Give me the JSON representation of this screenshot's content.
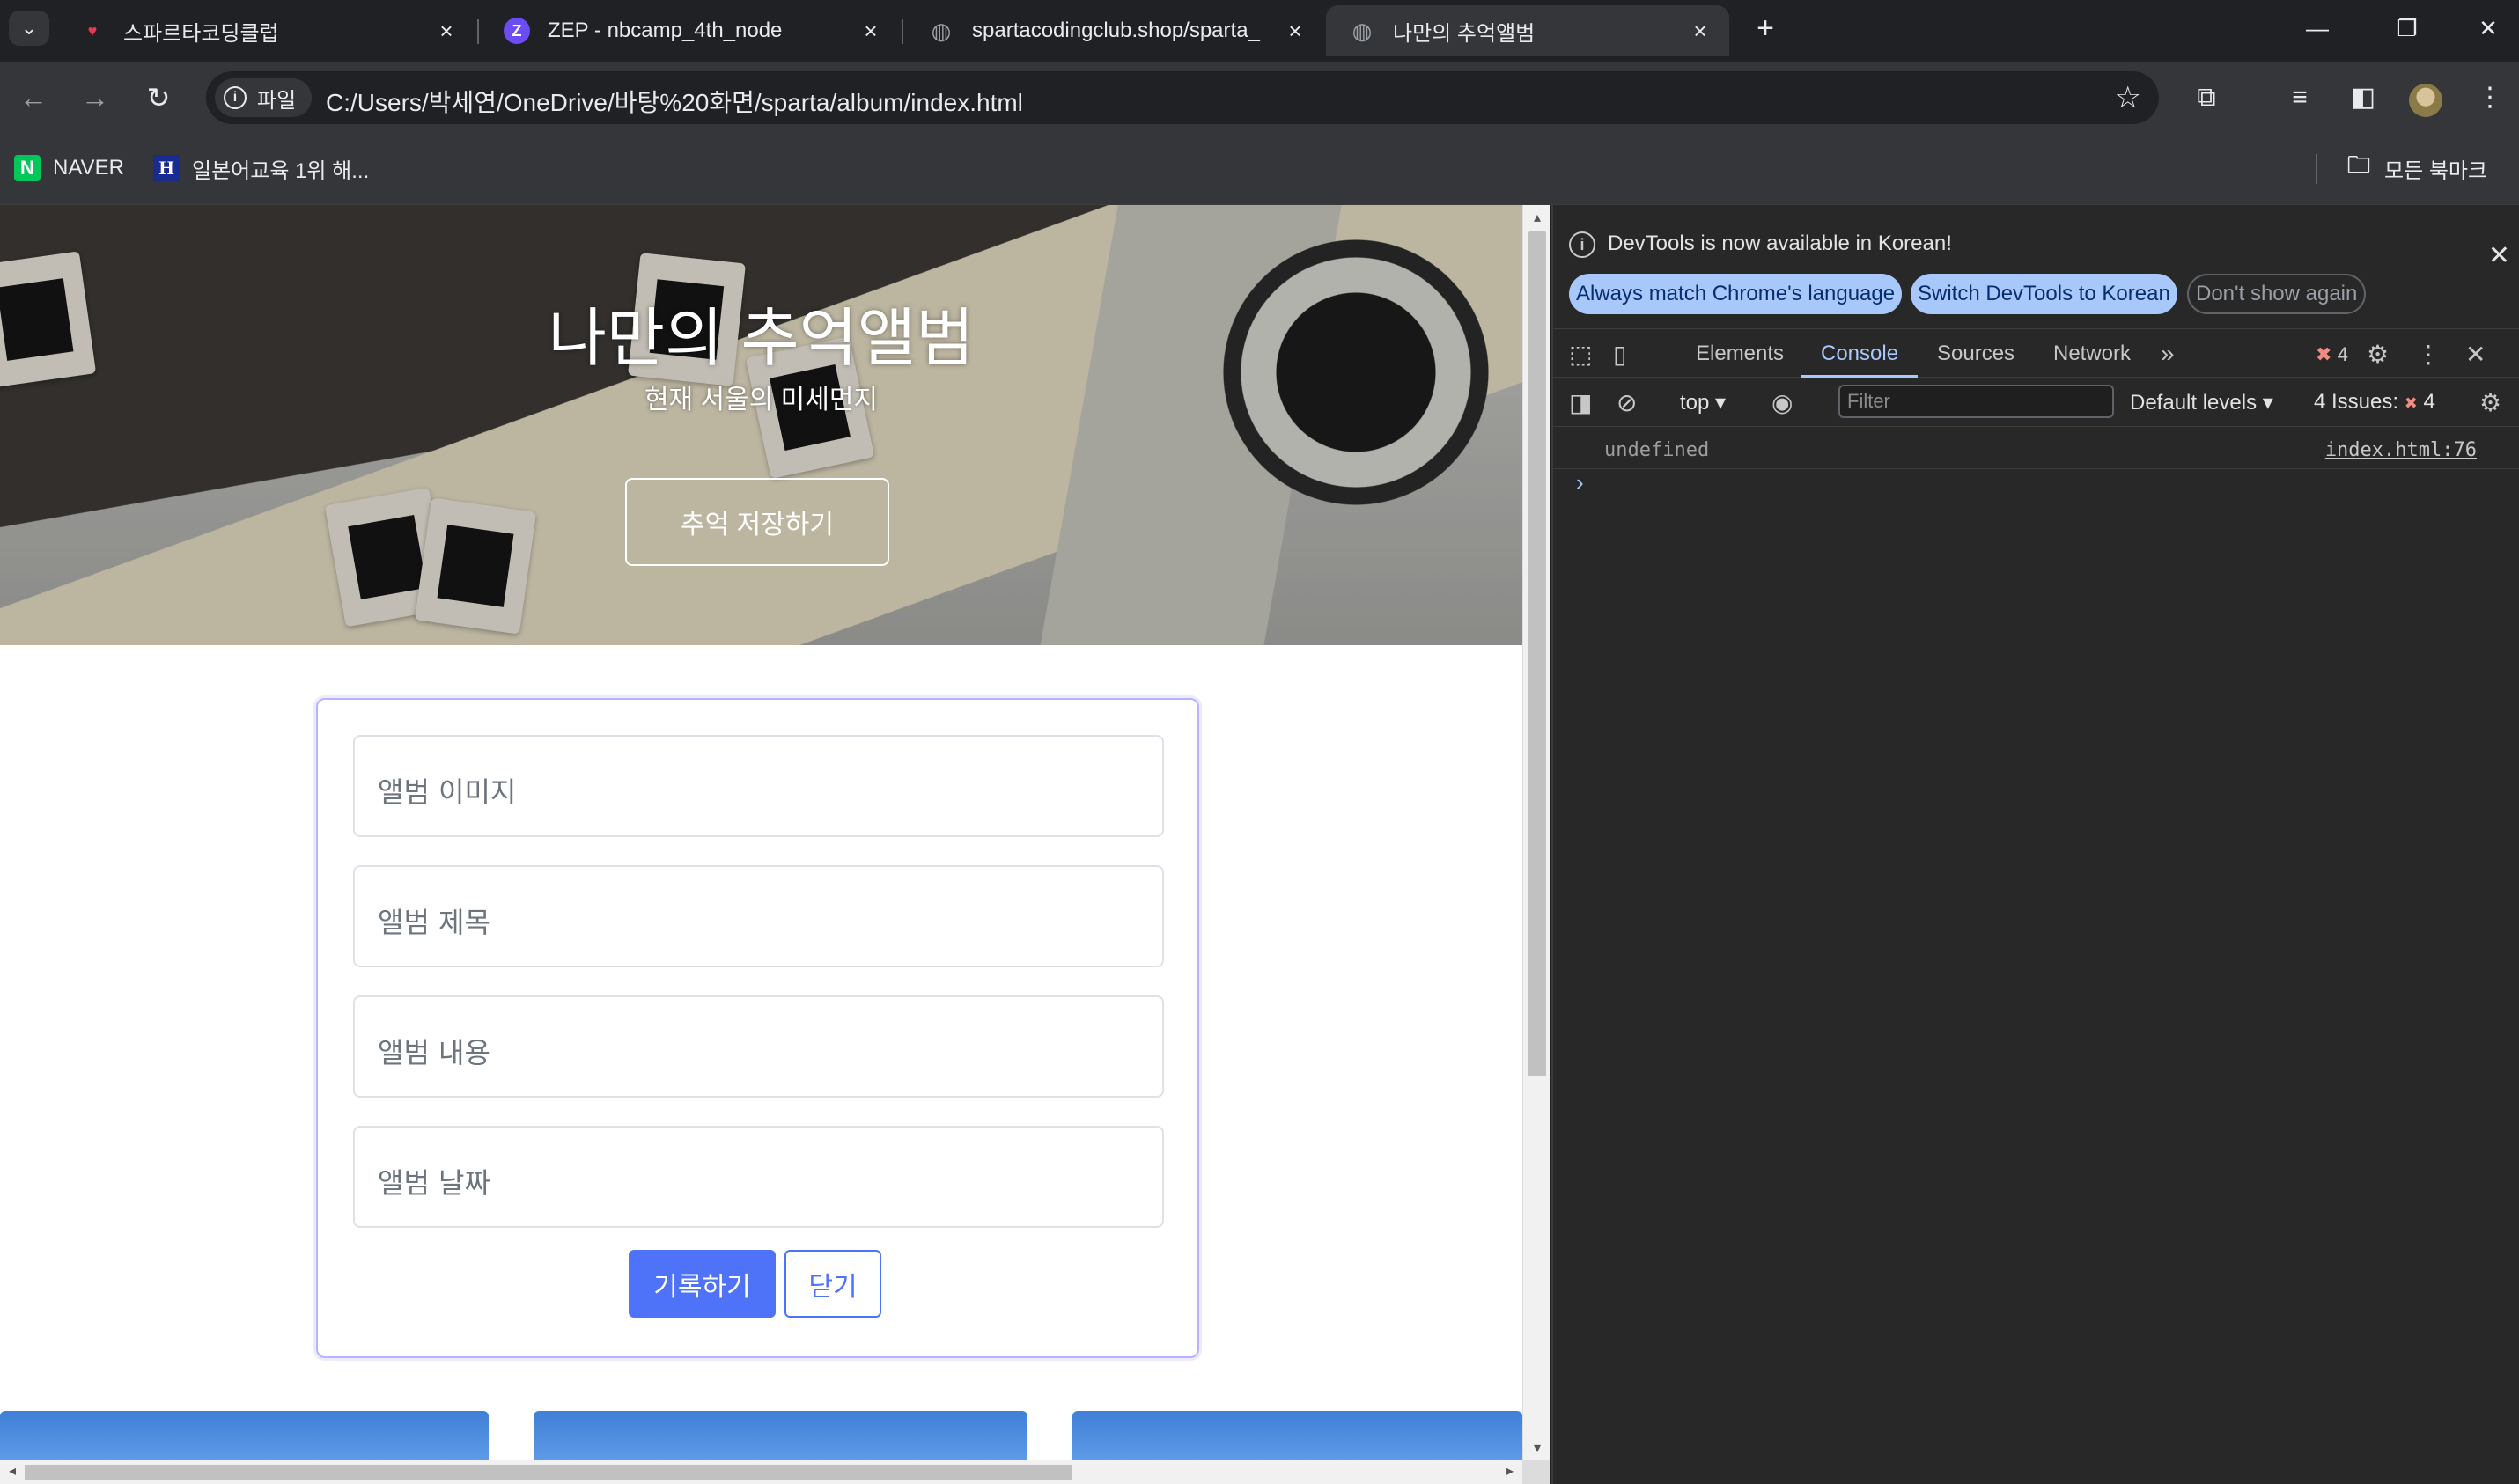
{
  "tabs": [
    {
      "title": "스파르타코딩클럽",
      "icon": "heart-icon",
      "color": "#e8384f"
    },
    {
      "title": "ZEP - nbcamp_4th_node",
      "icon": "zep-icon",
      "color": "#6c4cf5"
    },
    {
      "title": "spartacodingclub.shop/sparta_",
      "icon": "globe-icon",
      "color": "#9aa0a6"
    },
    {
      "title": "나만의 추억앨범",
      "icon": "globe-icon",
      "color": "#9aa0a6",
      "active": true
    }
  ],
  "toolbar": {
    "chip_label": "파일",
    "url": "C:/Users/박세연/OneDrive/바탕%20화면/sparta/album/index.html"
  },
  "bookmarks": {
    "items": [
      {
        "label": "NAVER",
        "icon": "naver-icon",
        "color": "#03c75a"
      },
      {
        "label": "일본어교육 1위 해...",
        "icon": "hackers-icon",
        "color": "#1a2b8f"
      }
    ],
    "all_bookmarks": "모든 북마크"
  },
  "page": {
    "hero": {
      "title": "나만의 추억앨범",
      "subtitle": "현재 서울의 미세먼지",
      "button": "추억 저장하기"
    },
    "form": {
      "fields": [
        "앨범 이미지",
        "앨범 제목",
        "앨범 내용",
        "앨범 날짜"
      ],
      "submit": "기록하기",
      "close": "닫기"
    },
    "accent": "#4e73f8"
  },
  "devtools": {
    "banner": {
      "text": "DevTools is now available in Korean!",
      "btn_match": "Always match Chrome's language",
      "btn_switch": "Switch DevTools to Korean",
      "btn_dismiss": "Don't show again"
    },
    "tabs": [
      "Elements",
      "Console",
      "Sources",
      "Network"
    ],
    "active_tab": "Console",
    "error_count": "4",
    "context": "top",
    "filter_placeholder": "Filter",
    "levels": "Default levels",
    "issues_label": "4 Issues:",
    "issues_count": "4",
    "log": {
      "text": "undefined",
      "source": "index.html:76"
    }
  }
}
